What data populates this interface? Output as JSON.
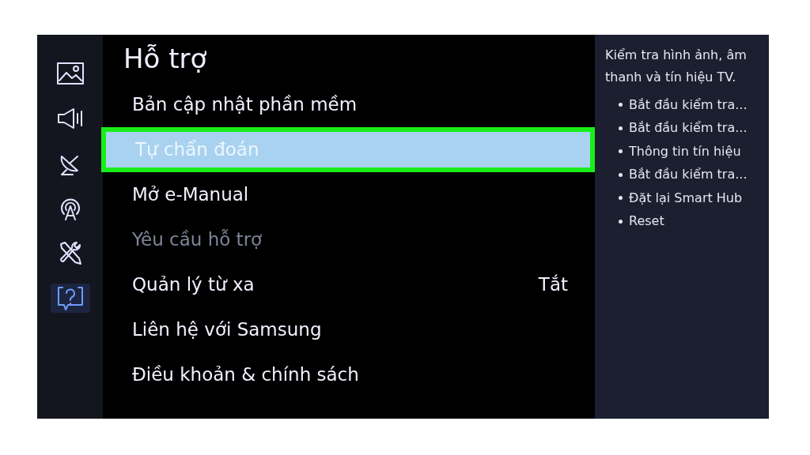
{
  "sidebar": {
    "items": [
      {
        "kind": "picture",
        "selected": false
      },
      {
        "kind": "sound",
        "selected": false
      },
      {
        "kind": "broadcast",
        "selected": false
      },
      {
        "kind": "network",
        "selected": false
      },
      {
        "kind": "tools",
        "selected": false
      },
      {
        "kind": "support",
        "selected": true
      }
    ]
  },
  "menu": {
    "title": "Hỗ trợ",
    "items": [
      {
        "label": "Bản cập nhật phần mềm",
        "selected": false,
        "disabled": false
      },
      {
        "label": "Tự chẩn đoán",
        "selected": true,
        "disabled": false
      },
      {
        "label": "Mở e-Manual",
        "selected": false,
        "disabled": false
      },
      {
        "label": "Yêu cầu hỗ trợ",
        "selected": false,
        "disabled": true
      },
      {
        "label": "Quản lý từ xa",
        "value": "Tắt",
        "selected": false,
        "disabled": false
      },
      {
        "label": "Liên hệ với Samsung",
        "selected": false,
        "disabled": false
      },
      {
        "label": "Điều khoản & chính sách",
        "selected": false,
        "disabled": false
      }
    ]
  },
  "info_panel": {
    "description": "Kiểm tra hình ảnh, âm thanh và tín hiệu TV.",
    "items": [
      "Bắt đầu kiểm tra...",
      "Bắt đầu kiểm tra...",
      "Thông tin tín hiệu",
      "Bắt đầu kiểm tra...",
      "Đặt lại Smart Hub",
      "Reset"
    ]
  }
}
